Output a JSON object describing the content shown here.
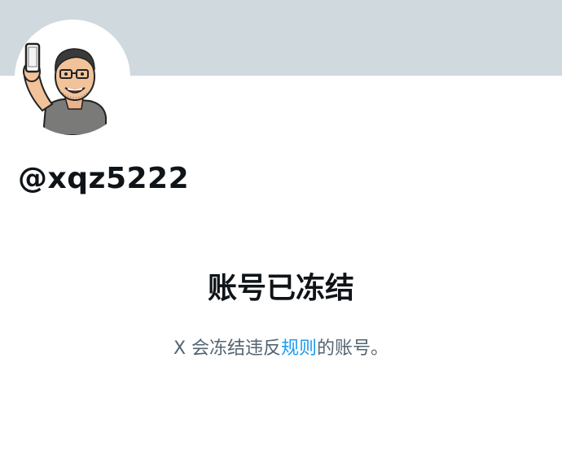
{
  "profile": {
    "avatar_icon": "cartoon-man-holding-phone",
    "handle": "@xqz5222"
  },
  "notice": {
    "title": "账号已冻结",
    "body_prefix": "X 会冻结违反",
    "rules_link": "规则",
    "body_suffix": "的账号。"
  },
  "colors": {
    "banner": "#cfd9de",
    "text_primary": "#0f1419",
    "text_secondary": "#536471",
    "link": "#1d9bf0"
  }
}
